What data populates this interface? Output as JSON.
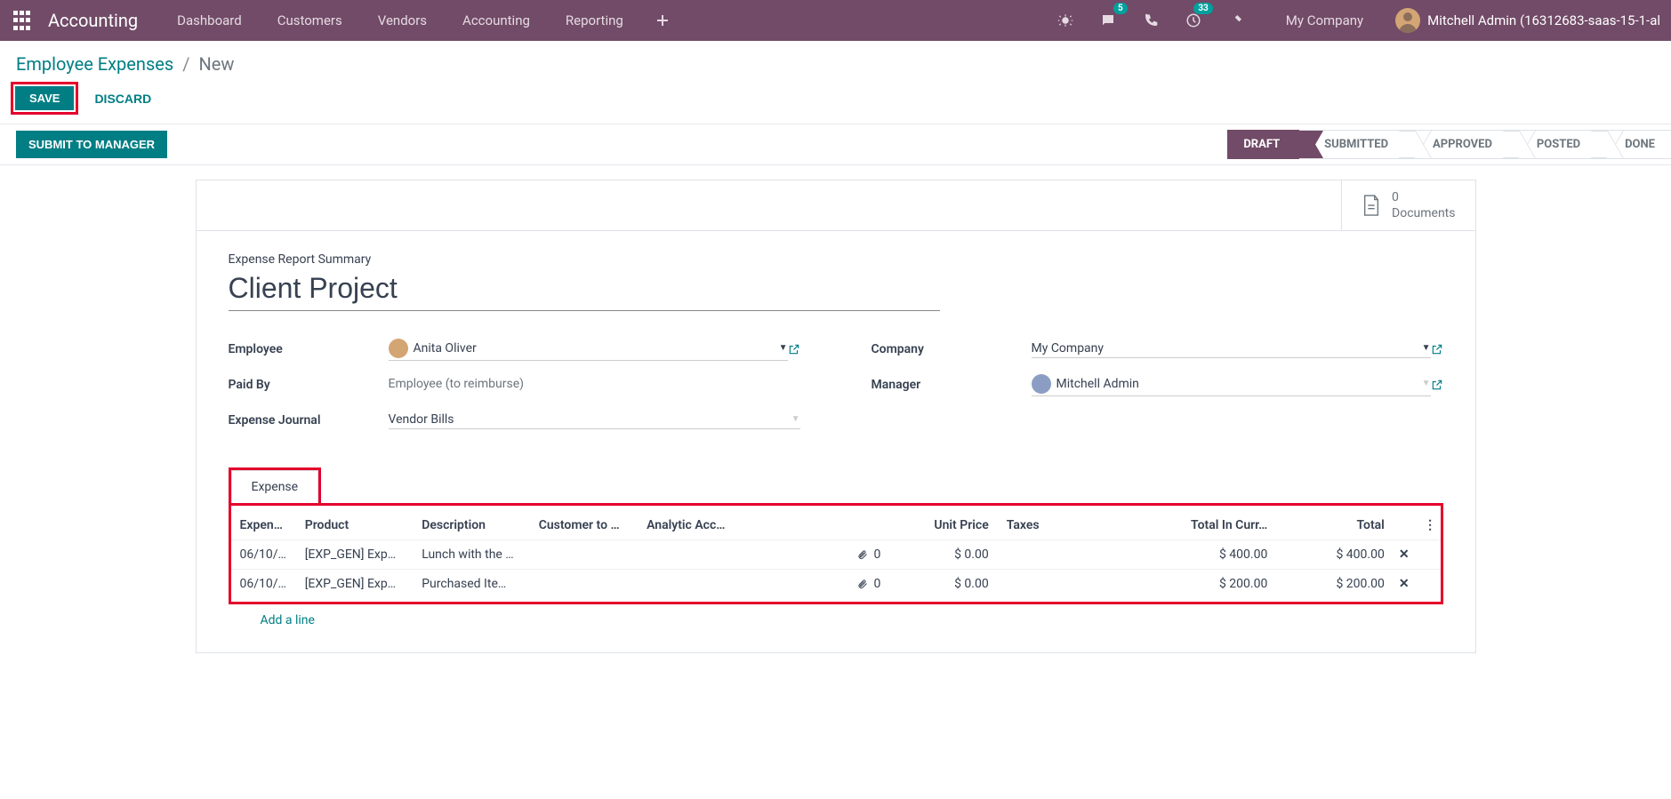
{
  "navbar": {
    "brand": "Accounting",
    "links": [
      "Dashboard",
      "Customers",
      "Vendors",
      "Accounting",
      "Reporting"
    ],
    "messages_badge": "5",
    "activities_badge": "33",
    "company": "My Company",
    "user_name": "Mitchell Admin (16312683-saas-15-1-al"
  },
  "breadcrumb": {
    "parent": "Employee Expenses",
    "current": "New"
  },
  "actions": {
    "save": "SAVE",
    "discard": "DISCARD",
    "submit": "SUBMIT TO MANAGER"
  },
  "status_steps": [
    "DRAFT",
    "SUBMITTED",
    "APPROVED",
    "POSTED",
    "DONE"
  ],
  "documents": {
    "count": "0",
    "label": "Documents"
  },
  "form": {
    "summary_label": "Expense Report Summary",
    "title": "Client Project",
    "employee_label": "Employee",
    "employee_value": "Anita Oliver",
    "paid_by_label": "Paid By",
    "paid_by_value": "Employee (to reimburse)",
    "journal_label": "Expense Journal",
    "journal_value": "Vendor Bills",
    "company_label": "Company",
    "company_value": "My Company",
    "manager_label": "Manager",
    "manager_value": "Mitchell Admin"
  },
  "tab_label": "Expense",
  "table": {
    "headers": {
      "date": "Expen…",
      "product": "Product",
      "description": "Description",
      "customer": "Customer to …",
      "analytic": "Analytic Acc…",
      "unit_price": "Unit Price",
      "taxes": "Taxes",
      "total_curr": "Total In Curr…",
      "total": "Total"
    },
    "rows": [
      {
        "date": "06/10/…",
        "product": "[EXP_GEN] Exp…",
        "description": "Lunch with the …",
        "attach": "0",
        "unit_price": "$ 0.00",
        "total_curr": "$ 400.00",
        "total": "$ 400.00"
      },
      {
        "date": "06/10/…",
        "product": "[EXP_GEN] Exp…",
        "description": "Purchased Ite…",
        "attach": "0",
        "unit_price": "$ 0.00",
        "total_curr": "$ 200.00",
        "total": "$ 200.00"
      }
    ],
    "add_line": "Add a line"
  }
}
